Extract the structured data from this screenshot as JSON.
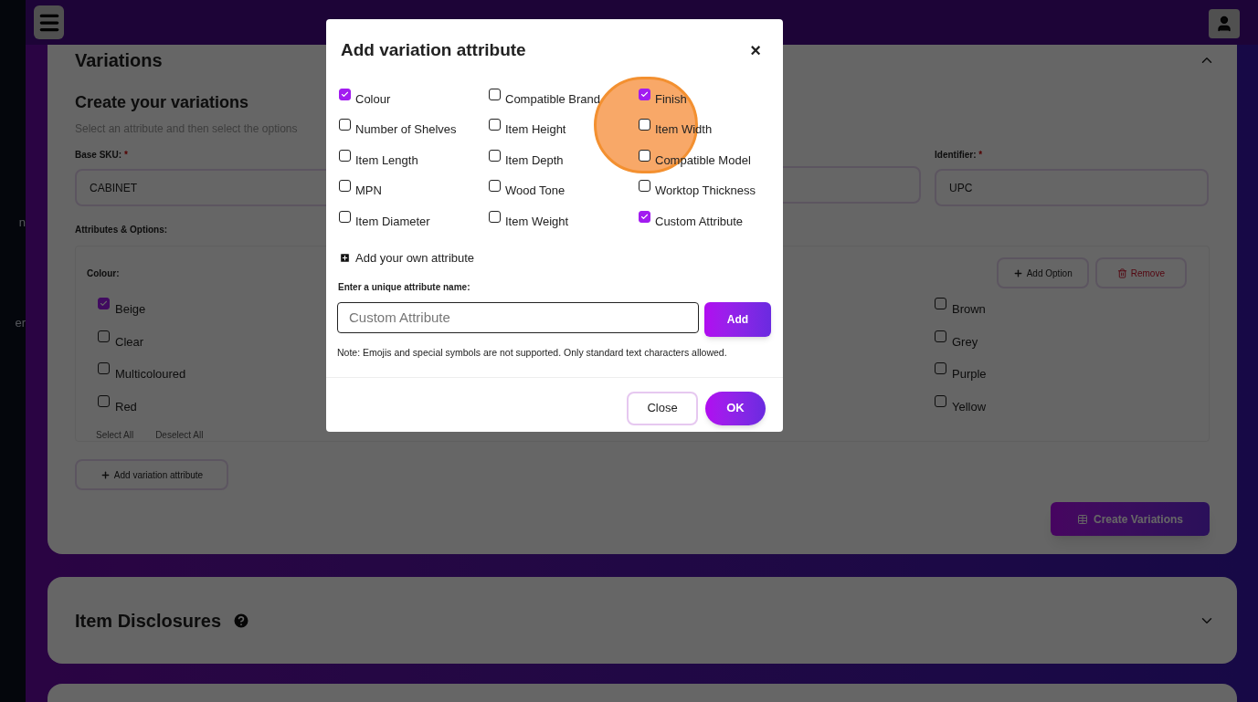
{
  "sidebar": {
    "items": [
      "n",
      "er"
    ]
  },
  "variations": {
    "title": "Variations",
    "heading": "Create your variations",
    "subtitle": "Select an attribute and then select the options",
    "base_sku": {
      "label": "Base SKU:",
      "required": "*",
      "value": "CABINET"
    },
    "identifier": {
      "label": "Identifier:",
      "required": "*",
      "value": "UPC"
    },
    "attributes_label": "Attributes & Options:",
    "attribute": {
      "name": "Colour:",
      "add_option": "Add Option",
      "remove": "Remove",
      "option_columns": [
        {
          "options": [
            {
              "label": "Beige",
              "checked": true
            },
            {
              "label": "Clear",
              "checked": false
            },
            {
              "label": "Multicoloured",
              "checked": false
            },
            {
              "label": "Red",
              "checked": false
            }
          ]
        },
        {
          "options": [
            {
              "label": "Brown",
              "checked": false
            },
            {
              "label": "Grey",
              "checked": false
            },
            {
              "label": "Purple",
              "checked": false
            },
            {
              "label": "Yellow",
              "checked": false
            }
          ]
        }
      ],
      "select_all": "Select All",
      "deselect_all": "Deselect All"
    },
    "add_variation_attribute": "Add variation attribute",
    "create_variations": "Create Variations"
  },
  "item_disclosures": {
    "title": "Item Disclosures",
    "expanded": false
  },
  "dialog": {
    "title": "Add variation attribute",
    "close_icon": "×",
    "attributes": [
      {
        "label": "Colour",
        "checked": true
      },
      {
        "label": "Compatible Brand",
        "checked": false
      },
      {
        "label": "Finish",
        "checked": true
      },
      {
        "label": "Number of Shelves",
        "checked": false
      },
      {
        "label": "Item Height",
        "checked": false
      },
      {
        "label": "Item Width",
        "checked": false
      },
      {
        "label": "Item Length",
        "checked": false
      },
      {
        "label": "Item Depth",
        "checked": false
      },
      {
        "label": "Compatible Model",
        "checked": false
      },
      {
        "label": "MPN",
        "checked": false
      },
      {
        "label": "Wood Tone",
        "checked": false
      },
      {
        "label": "Worktop Thickness",
        "checked": false
      },
      {
        "label": "Item Diameter",
        "checked": false
      },
      {
        "label": "Item Weight",
        "checked": false
      },
      {
        "label": "Custom Attribute",
        "checked": true
      }
    ],
    "add_own": "Add your own attribute",
    "name_label": "Enter a unique attribute name:",
    "name_placeholder": "Custom Attribute",
    "add_button": "Add",
    "note": "Note: Emojis and special symbols are not supported. Only standard text characters allowed.",
    "close_button": "Close",
    "ok_button": "OK"
  }
}
